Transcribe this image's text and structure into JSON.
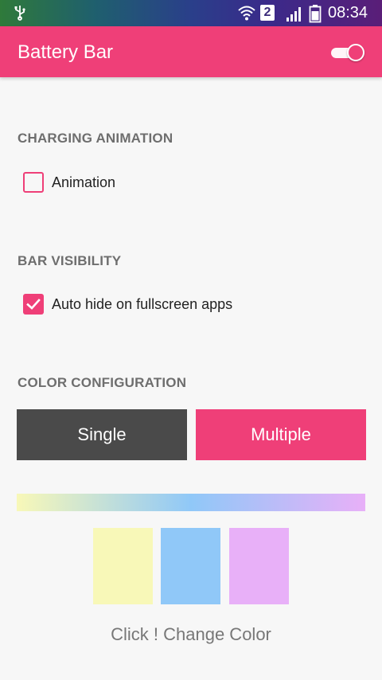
{
  "status_bar": {
    "sim_number": "2",
    "time": "08:34",
    "icons": [
      "usb-icon",
      "wifi-icon",
      "sim-icon",
      "signal-icon",
      "battery-icon"
    ]
  },
  "app_bar": {
    "title": "Battery Bar",
    "master_toggle_on": true
  },
  "sections": {
    "charging": {
      "header": "CHARGING ANIMATION",
      "checkbox_label": "Animation",
      "checked": false
    },
    "visibility": {
      "header": "BAR VISIBILITY",
      "checkbox_label": "Auto hide on fullscreen apps",
      "checked": true
    },
    "color": {
      "header": "COLOR CONFIGURATION",
      "single_label": "Single",
      "multiple_label": "Multiple",
      "selected_mode": "Multiple",
      "swatch_colors": [
        "#f8f8b8",
        "#90c8f8",
        "#e8b0f8"
      ],
      "change_color_label": "Click ! Change Color"
    }
  },
  "colors": {
    "accent": "#ef3f78",
    "single_button": "#4a4a4a",
    "background": "#f7f7f7"
  }
}
